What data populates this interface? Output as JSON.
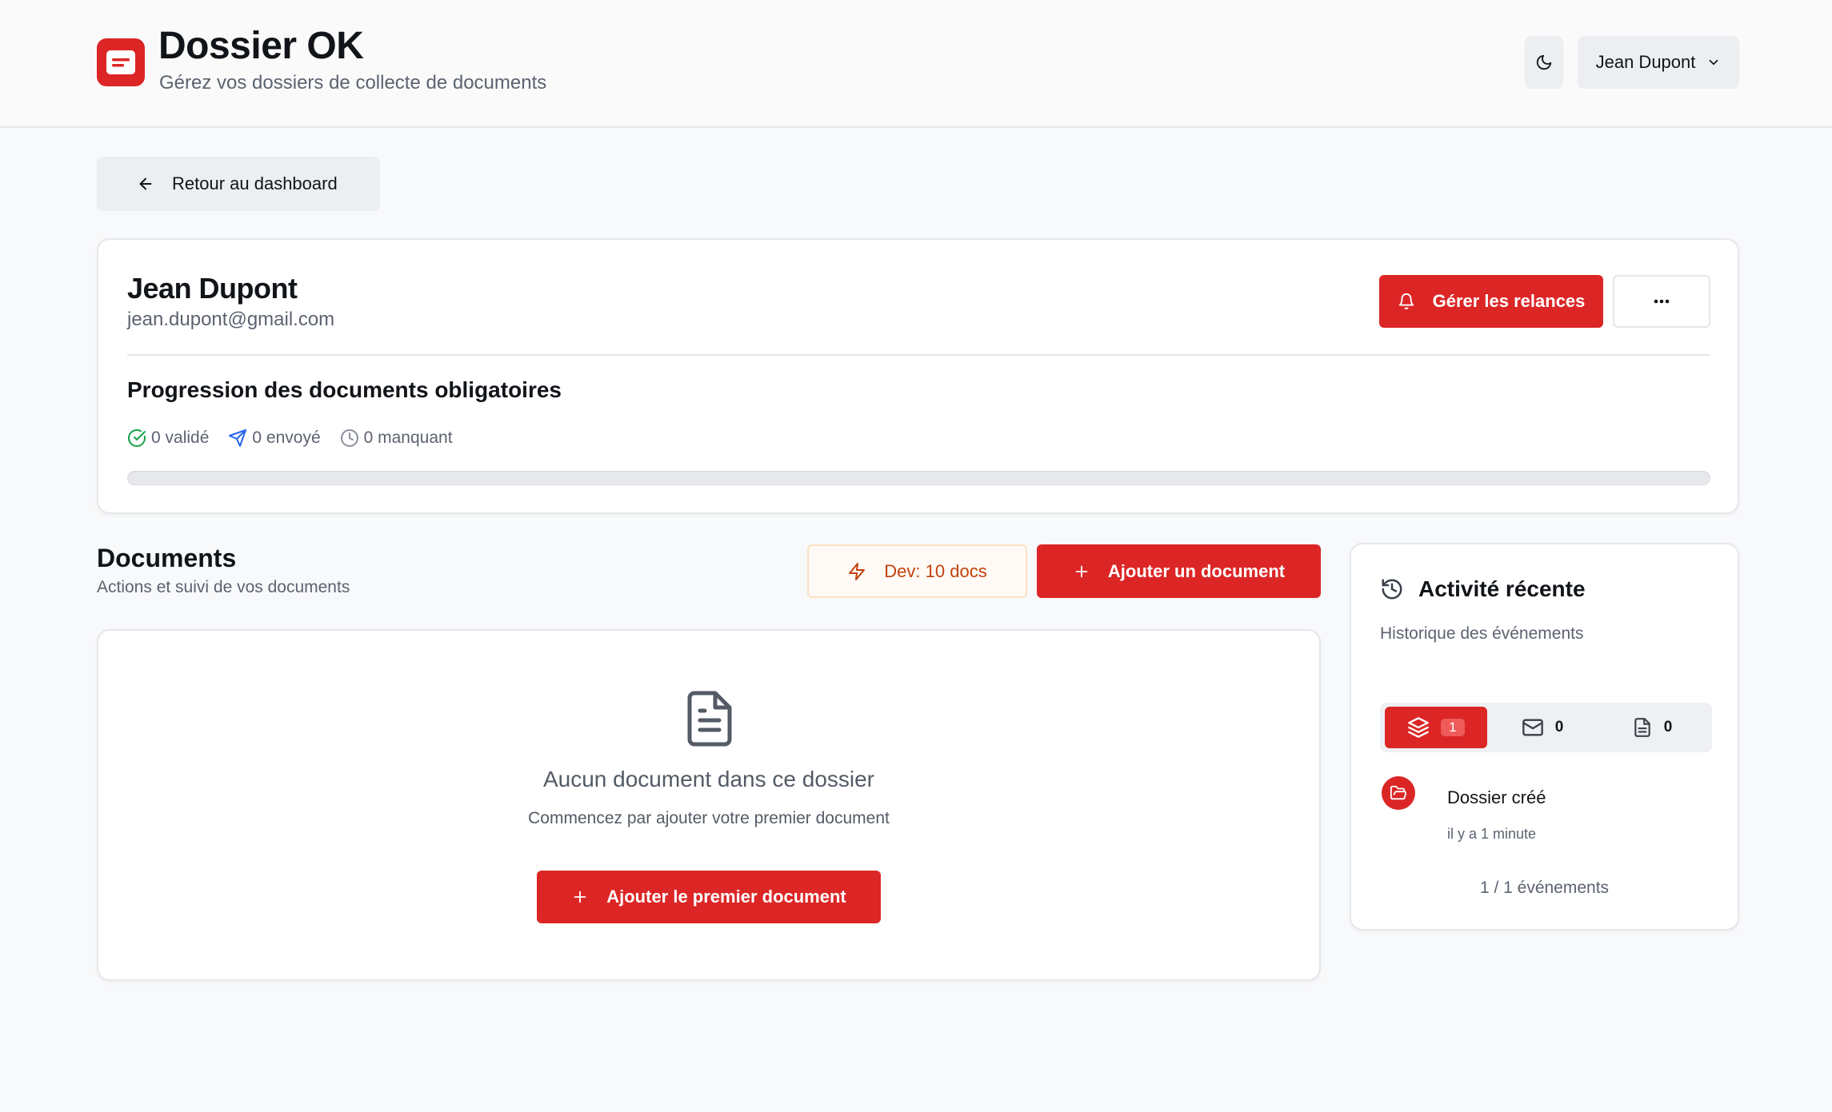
{
  "header": {
    "title": "Dossier OK",
    "subtitle": "Gérez vos dossiers de collecte de documents",
    "user_name": "Jean Dupont",
    "brand_color": "#dc2626"
  },
  "nav": {
    "back_label": "Retour au dashboard"
  },
  "client": {
    "name": "Jean Dupont",
    "email": "jean.dupont@gmail.com",
    "relances_label": "Gérer les relances",
    "more_label": "···"
  },
  "progress": {
    "title": "Progression des documents obligatoires",
    "validated": "0 validé",
    "sent": "0 envoyé",
    "missing": "0 manquant",
    "fraction": 0
  },
  "documents": {
    "title": "Documents",
    "subtitle": "Actions et suivi de vos documents",
    "dev_label": "Dev: 10 docs",
    "add_label": "Ajouter un document",
    "empty_title": "Aucun document dans ce dossier",
    "empty_subtitle": "Commencez par ajouter votre premier document",
    "add_first_label": "Ajouter le premier document"
  },
  "activity": {
    "title": "Activité récente",
    "subtitle": "Historique des événements",
    "tabs": [
      {
        "icon": "layers-icon",
        "count": "1"
      },
      {
        "icon": "mail-icon",
        "count": "0"
      },
      {
        "icon": "file-icon",
        "count": "0"
      }
    ],
    "events": [
      {
        "title": "Dossier créé",
        "time": "il y a 1 minute",
        "icon": "folder-open-icon"
      }
    ],
    "count_label": "1 / 1 événements"
  }
}
